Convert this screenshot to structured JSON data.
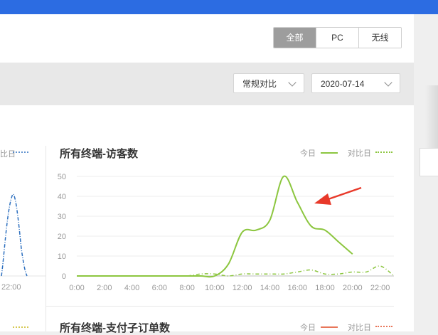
{
  "filter": {
    "tabs": [
      "全部",
      "PC",
      "无线"
    ],
    "compare_mode": "常规对比",
    "date": "2020-07-14"
  },
  "left_chart": {
    "legend_compare": "比日",
    "x_tick": "22:00"
  },
  "main_chart": {
    "title": "所有终端-访客数",
    "legend_today": "今日",
    "legend_compare": "对比日",
    "colors": {
      "today": "#8cc63f",
      "compare": "#8cc63f",
      "arrow": "#e8392a"
    }
  },
  "second_chart": {
    "title": "所有终端-支付子订单数",
    "legend_today": "今日",
    "legend_compare": "对比日",
    "colors": {
      "today": "#e8765a",
      "compare": "#e8765a"
    }
  },
  "chart_data": {
    "type": "line",
    "title": "所有终端-访客数",
    "x": [
      "0:00",
      "1:00",
      "2:00",
      "3:00",
      "4:00",
      "5:00",
      "6:00",
      "7:00",
      "8:00",
      "9:00",
      "10:00",
      "11:00",
      "12:00",
      "13:00",
      "14:00",
      "15:00",
      "16:00",
      "17:00",
      "18:00",
      "19:00",
      "20:00",
      "21:00",
      "22:00",
      "23:00"
    ],
    "x_tick_labels": [
      "0:00",
      "2:00",
      "4:00",
      "6:00",
      "8:00",
      "10:00",
      "12:00",
      "14:00",
      "16:00",
      "18:00",
      "20:00",
      "22:00"
    ],
    "y_tick_labels": [
      "0",
      "10",
      "20",
      "30",
      "40",
      "50"
    ],
    "ylim": [
      0,
      50
    ],
    "grid": true,
    "legend_position": "top-right",
    "series": [
      {
        "name": "今日",
        "values": [
          0,
          0,
          0,
          0,
          0,
          0,
          0,
          0,
          0,
          0,
          0,
          6,
          22,
          23,
          28,
          50,
          37,
          25,
          23,
          17,
          11,
          null,
          null,
          null
        ]
      },
      {
        "name": "对比日",
        "values": [
          0,
          0,
          0,
          0,
          0,
          0,
          0,
          0,
          0,
          1,
          1,
          0,
          1,
          1,
          1,
          1,
          2,
          3,
          1,
          1,
          2,
          2,
          5,
          0
        ]
      }
    ]
  }
}
